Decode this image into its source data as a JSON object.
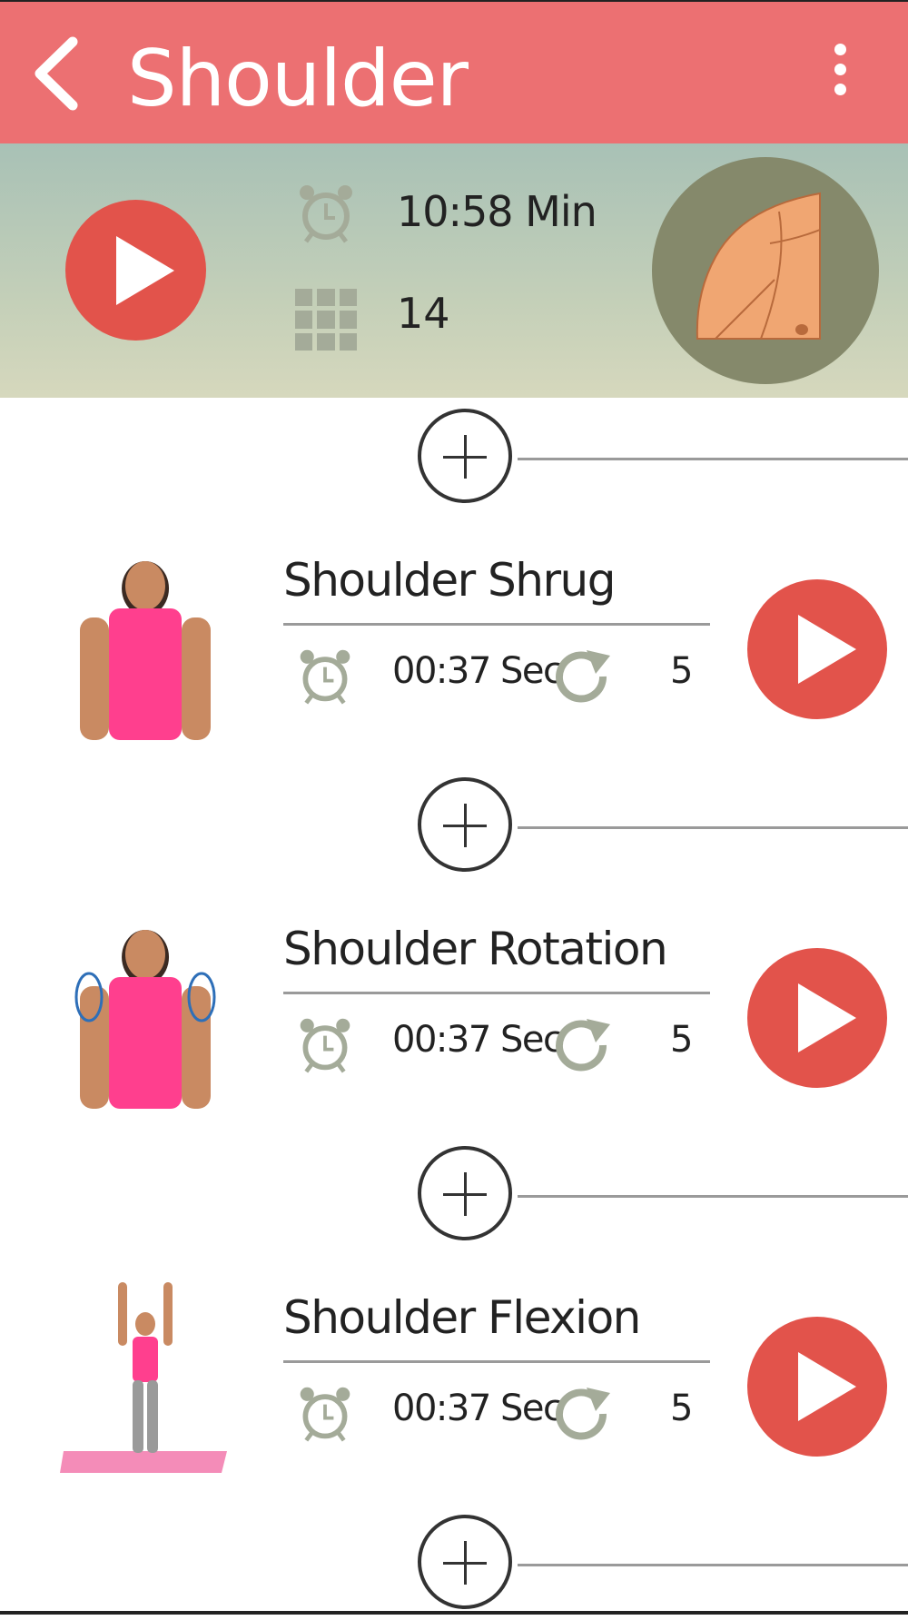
{
  "header": {
    "title": "Shoulder",
    "back_icon": "chevron-left-icon",
    "menu_icon": "overflow-menu-icon",
    "color": "#ec7072"
  },
  "summary": {
    "duration": "10:58 Min",
    "exercise_count": "14",
    "play_color": "#e2534b",
    "muscle_image": "shoulder-muscle-illustration"
  },
  "exercises": [
    {
      "name": "Shoulder Shrug",
      "time": "00:37 Sec",
      "reps": "5"
    },
    {
      "name": "Shoulder Rotation",
      "time": "00:37 Sec",
      "reps": "5"
    },
    {
      "name": "Shoulder Flexion",
      "time": "00:37 Sec",
      "reps": "5"
    }
  ]
}
